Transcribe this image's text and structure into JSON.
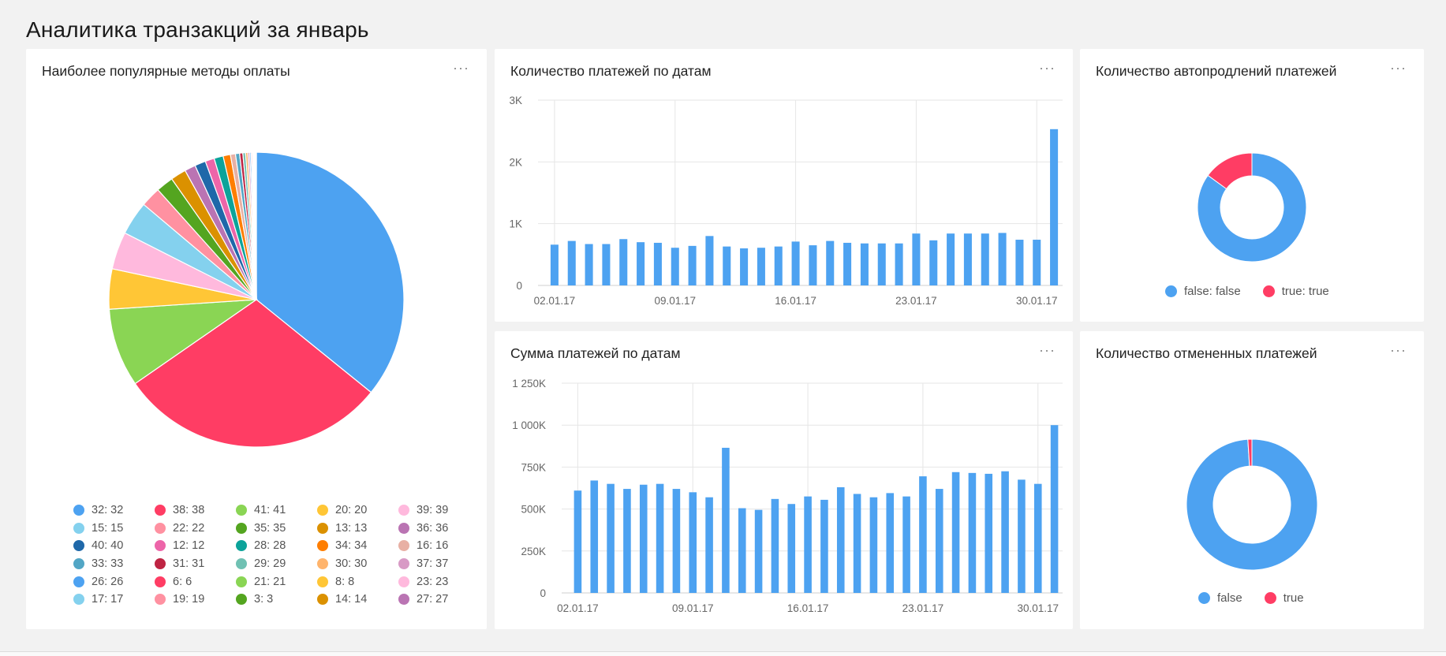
{
  "page": {
    "title": "Аналитика транзакций за январь",
    "menu_icon": "more-horizontal-icon",
    "menu_glyph": "···"
  },
  "colors": {
    "blue": "#4da2f1",
    "red": "#ff3d64",
    "bg": "#f2f2f2"
  },
  "pie_card": {
    "title": "Наиболее популярные методы оплаты",
    "chart_data": {
      "type": "pie",
      "slices": [
        {
          "label": "32: 32",
          "value": 35.8,
          "color": "#4da2f1"
        },
        {
          "label": "38: 38",
          "value": 29.5,
          "color": "#ff3d64"
        },
        {
          "label": "41: 41",
          "value": 8.6,
          "color": "#8ad554"
        },
        {
          "label": "20: 20",
          "value": 4.4,
          "color": "#ffc636"
        },
        {
          "label": "39: 39",
          "value": 4.1,
          "color": "#ffb9dd"
        },
        {
          "label": "15: 15",
          "value": 3.7,
          "color": "#84d1ee"
        },
        {
          "label": "22: 22",
          "value": 2.2,
          "color": "#ff91a1"
        },
        {
          "label": "35: 35",
          "value": 1.9,
          "color": "#54a520"
        },
        {
          "label": "13: 13",
          "value": 1.7,
          "color": "#db9100"
        },
        {
          "label": "36: 36",
          "value": 1.2,
          "color": "#ba74b3"
        },
        {
          "label": "40: 40",
          "value": 1.2,
          "color": "#1f68a9"
        },
        {
          "label": "12: 12",
          "value": 1.0,
          "color": "#ed65a9"
        },
        {
          "label": "28: 28",
          "value": 1.0,
          "color": "#0ca39a"
        },
        {
          "label": "34: 34",
          "value": 0.8,
          "color": "#ff7e00"
        },
        {
          "label": "16: 16",
          "value": 0.55,
          "color": "#e8b0a4"
        },
        {
          "label": "33: 33",
          "value": 0.45,
          "color": "#52a6c5"
        },
        {
          "label": "31: 31",
          "value": 0.35,
          "color": "#be2443"
        },
        {
          "label": "29: 29",
          "value": 0.3,
          "color": "#70c1b3"
        },
        {
          "label": "30: 30",
          "value": 0.25,
          "color": "#ffb46c"
        },
        {
          "label": "37: 37",
          "value": 0.2,
          "color": "#d89ac5"
        },
        {
          "label": "26: 26",
          "value": 0.15,
          "color": "#4da2f1"
        },
        {
          "label": "6: 6",
          "value": 0.12,
          "color": "#ff3d64"
        },
        {
          "label": "21: 21",
          "value": 0.1,
          "color": "#8ad554"
        },
        {
          "label": "8: 8",
          "value": 0.08,
          "color": "#ffc636"
        },
        {
          "label": "23: 23",
          "value": 0.07,
          "color": "#ffb9dd"
        },
        {
          "label": "17: 17",
          "value": 0.06,
          "color": "#84d1ee"
        },
        {
          "label": "19: 19",
          "value": 0.05,
          "color": "#ff91a1"
        },
        {
          "label": "3: 3",
          "value": 0.04,
          "color": "#54a520"
        },
        {
          "label": "14: 14",
          "value": 0.03,
          "color": "#db9100"
        },
        {
          "label": "27: 27",
          "value": 0.02,
          "color": "#ba74b3"
        }
      ]
    }
  },
  "count_card": {
    "title": "Количество платежей по датам",
    "chart_data": {
      "type": "bar",
      "x": [
        "02.01.17",
        "03.01.17",
        "04.01.17",
        "05.01.17",
        "06.01.17",
        "07.01.17",
        "08.01.17",
        "09.01.17",
        "10.01.17",
        "11.01.17",
        "12.01.17",
        "13.01.17",
        "14.01.17",
        "15.01.17",
        "16.01.17",
        "17.01.17",
        "18.01.17",
        "19.01.17",
        "20.01.17",
        "21.01.17",
        "22.01.17",
        "23.01.17",
        "24.01.17",
        "25.01.17",
        "26.01.17",
        "27.01.17",
        "28.01.17",
        "29.01.17",
        "30.01.17",
        "31.01.17"
      ],
      "values": [
        660,
        720,
        670,
        670,
        750,
        700,
        690,
        610,
        640,
        800,
        630,
        600,
        610,
        630,
        710,
        650,
        720,
        690,
        680,
        680,
        680,
        840,
        730,
        840,
        840,
        840,
        850,
        740,
        740,
        2530
      ],
      "ylim": [
        0,
        3000
      ],
      "yticks": [
        {
          "v": 0,
          "label": "0"
        },
        {
          "v": 1000,
          "label": "1K"
        },
        {
          "v": 2000,
          "label": "2K"
        },
        {
          "v": 3000,
          "label": "3K"
        }
      ],
      "xtick_labels": [
        "02.01.17",
        "09.01.17",
        "16.01.17",
        "23.01.17",
        "30.01.17"
      ],
      "color": "#4da2f1"
    }
  },
  "sum_card": {
    "title": "Сумма платежей по датам",
    "chart_data": {
      "type": "bar",
      "x": [
        "02.01.17",
        "03.01.17",
        "04.01.17",
        "05.01.17",
        "06.01.17",
        "07.01.17",
        "08.01.17",
        "09.01.17",
        "10.01.17",
        "11.01.17",
        "12.01.17",
        "13.01.17",
        "14.01.17",
        "15.01.17",
        "16.01.17",
        "17.01.17",
        "18.01.17",
        "19.01.17",
        "20.01.17",
        "21.01.17",
        "22.01.17",
        "23.01.17",
        "24.01.17",
        "25.01.17",
        "26.01.17",
        "27.01.17",
        "28.01.17",
        "29.01.17",
        "30.01.17",
        "31.01.17"
      ],
      "values": [
        610000,
        670000,
        650000,
        620000,
        645000,
        650000,
        620000,
        600000,
        570000,
        865000,
        505000,
        495000,
        560000,
        530000,
        575000,
        555000,
        630000,
        590000,
        570000,
        595000,
        575000,
        695000,
        620000,
        720000,
        715000,
        710000,
        725000,
        675000,
        650000,
        1000000
      ],
      "ylim": [
        0,
        1250000
      ],
      "yticks": [
        {
          "v": 0,
          "label": "0"
        },
        {
          "v": 250000,
          "label": "250K"
        },
        {
          "v": 500000,
          "label": "500K"
        },
        {
          "v": 750000,
          "label": "750K"
        },
        {
          "v": 1000000,
          "label": "1 000K"
        },
        {
          "v": 1250000,
          "label": "1 250K"
        }
      ],
      "xtick_labels": [
        "02.01.17",
        "09.01.17",
        "16.01.17",
        "23.01.17",
        "30.01.17"
      ],
      "color": "#4da2f1"
    }
  },
  "autoprolong_card": {
    "title": "Количество автопродлений платежей",
    "chart_data": {
      "type": "pie",
      "donut": true,
      "slices": [
        {
          "label": "false: false",
          "value": 85,
          "color": "#4da2f1"
        },
        {
          "label": "true: true",
          "value": 15,
          "color": "#ff3d64"
        }
      ]
    }
  },
  "cancel_card": {
    "title": "Количество отмененных платежей",
    "chart_data": {
      "type": "pie",
      "donut": true,
      "slices": [
        {
          "label": "false",
          "value": 99,
          "color": "#4da2f1"
        },
        {
          "label": "true",
          "value": 1,
          "color": "#ff3d64"
        }
      ]
    }
  }
}
